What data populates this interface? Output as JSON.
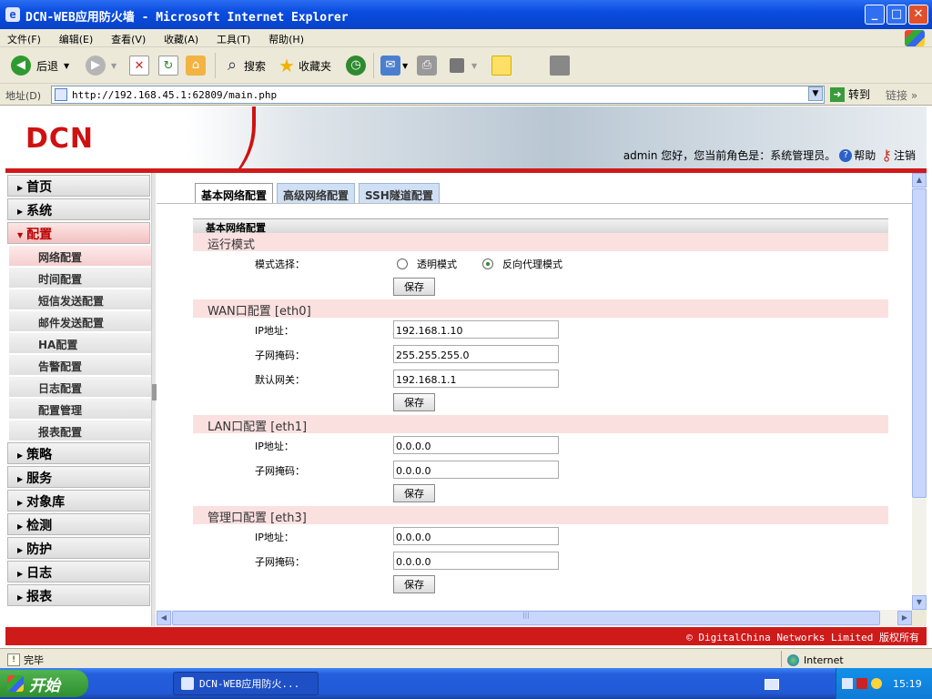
{
  "window": {
    "title": "DCN-WEB应用防火墙 - Microsoft Internet Explorer",
    "buttons": {
      "minimize": "_",
      "maximize": "□",
      "close": "✕"
    }
  },
  "menubar": [
    "文件(F)",
    "编辑(E)",
    "查看(V)",
    "收藏(A)",
    "工具(T)",
    "帮助(H)"
  ],
  "toolbar": {
    "back": "后退",
    "search": "搜索",
    "favorites": "收藏夹"
  },
  "addressbar": {
    "label": "地址(D)",
    "url": "http://192.168.45.1:62809/main.php",
    "go": "转到",
    "links": "链接"
  },
  "header": {
    "logo": "DCN",
    "user_text": "admin 您好，您当前角色是：系统管理员。",
    "help": "帮助",
    "logout": "注销"
  },
  "sidebar": {
    "top_items": [
      "首页",
      "系统"
    ],
    "active_item": "配置",
    "sub_items": [
      "网络配置",
      "时间配置",
      "短信发送配置",
      "邮件发送配置",
      "HA配置",
      "告警配置",
      "日志配置",
      "配置管理",
      "报表配置"
    ],
    "bottom_items": [
      "策略",
      "服务",
      "对象库",
      "检测",
      "防护",
      "日志",
      "报表"
    ]
  },
  "tabs": [
    "基本网络配置",
    "高级网络配置",
    "SSH隧道配置"
  ],
  "panel": {
    "title": "基本网络配置",
    "run_mode": {
      "heading": "运行模式",
      "label": "模式选择：",
      "options": [
        "透明模式",
        "反向代理模式"
      ],
      "selected": "反向代理模式",
      "save": "保存"
    },
    "wan": {
      "heading": "WAN口配置  [eth0]",
      "ip_label": "IP地址：",
      "ip": "192.168.1.10",
      "mask_label": "子网掩码：",
      "mask": "255.255.255.0",
      "gw_label": "默认网关：",
      "gw": "192.168.1.1",
      "save": "保存"
    },
    "lan": {
      "heading": "LAN口配置  [eth1]",
      "ip_label": "IP地址：",
      "ip": "0.0.0.0",
      "mask_label": "子网掩码：",
      "mask": "0.0.0.0",
      "save": "保存"
    },
    "mgmt": {
      "heading": "管理口配置  [eth3]",
      "ip_label": "IP地址：",
      "ip": "0.0.0.0",
      "mask_label": "子网掩码：",
      "mask": "0.0.0.0",
      "save": "保存"
    }
  },
  "footer": "© DigitalChina Networks Limited 版权所有",
  "statusbar": {
    "status": "完毕",
    "zone": "Internet"
  },
  "taskbar": {
    "start": "开始",
    "task": "DCN-WEB应用防火...",
    "clock": "15:19"
  },
  "colors": {
    "brand_red": "#cf1a1a",
    "section_bg": "#fbe0e0",
    "xp_blue": "#245edc"
  }
}
